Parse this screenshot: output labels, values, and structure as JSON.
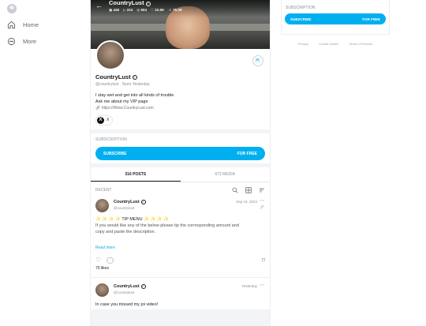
{
  "nav": {
    "items": [
      {
        "label": "Home",
        "icon": "home-icon"
      },
      {
        "label": "More",
        "icon": "more-icon"
      }
    ]
  },
  "cover": {
    "name": "CountryLust",
    "stats": {
      "photos": "448",
      "videos": "224",
      "streams": "504",
      "likes": "22.5K",
      "fans": "75.3K"
    }
  },
  "profile": {
    "name": "CountryLust",
    "handle": "@countrylust",
    "seen": "Seen Yesterday",
    "bio_line1": "I stay wet and get into all kinds of trouble",
    "bio_line2": "Ask me about my VIP page",
    "link": "https://Www.CountryLust.com",
    "social_label": "X"
  },
  "subscription": {
    "heading": "SUBSCRIPTION",
    "button_label": "SUBSCRIBE",
    "button_price": "FOR FREE"
  },
  "tabs": [
    {
      "label": "316 POSTS",
      "active": true
    },
    {
      "label": "672 MEDIA",
      "active": false
    }
  ],
  "feed": {
    "section_label": "RECENT",
    "posts": [
      {
        "name": "CountryLust",
        "handle": "@countrylust",
        "date": "Sep 19, 2024",
        "text_line1": "✨ ✨ ✨ ✨ TIP MENU ✨ ✨ ✨ ✨",
        "text_line2": "If you would like any of the below please tip the corresponding amount and",
        "text_line3": "copy and paste the description.",
        "read_more": "Read more",
        "likes": "70 likes"
      },
      {
        "name": "CountryLust",
        "handle": "@countrylust",
        "date": "Yesterday",
        "text_line1": "In case you missed my joi video!"
      }
    ]
  },
  "right_panel": {
    "heading": "SUBSCRIPTION",
    "button_label": "SUBSCRIBE",
    "button_price": "FOR FREE",
    "footer": [
      "Privacy",
      "Cookie Notice",
      "Terms of Service"
    ]
  },
  "colors": {
    "accent": "#00aff0",
    "separator": "#f2f4f6",
    "muted_text": "#8a9099"
  }
}
